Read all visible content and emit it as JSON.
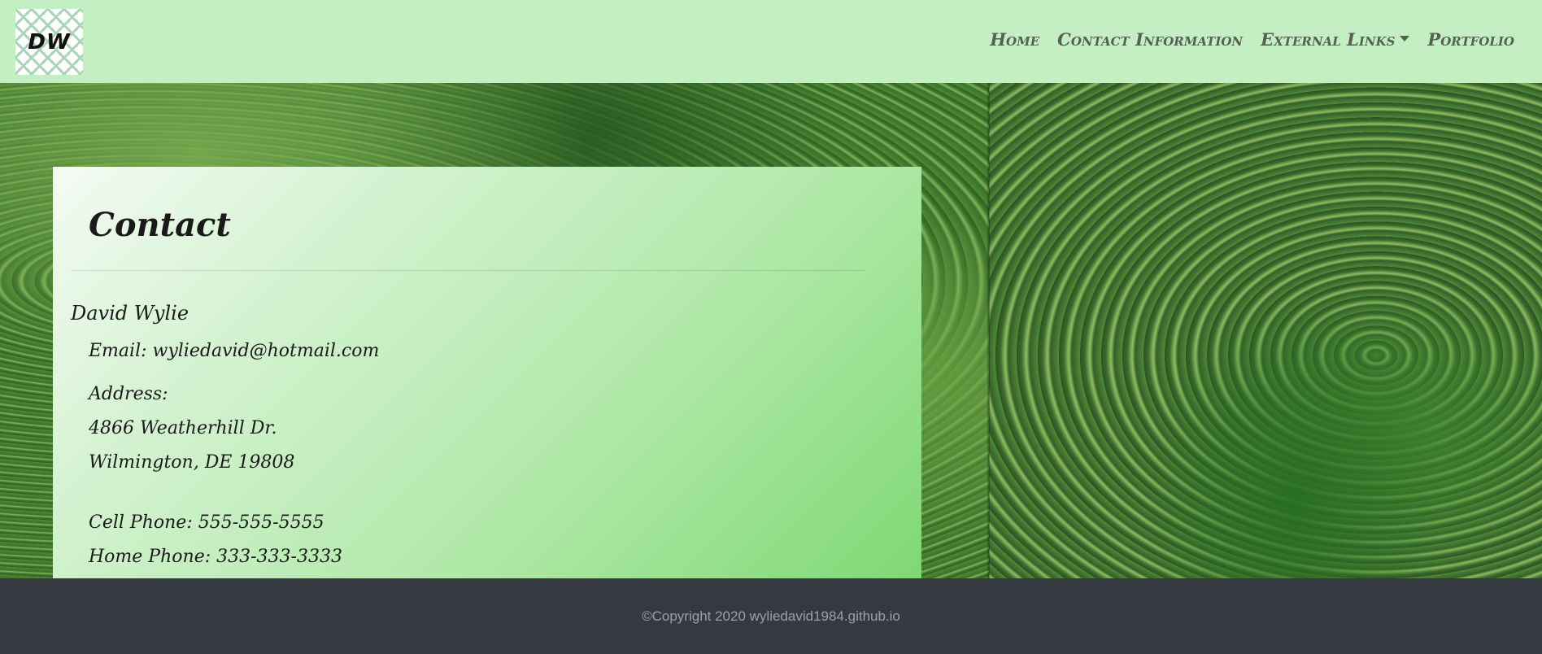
{
  "navbar": {
    "logo_text": "DW",
    "links": {
      "home": "Home",
      "contact": "Contact Information",
      "external": "External Links",
      "portfolio": "Portfolio"
    }
  },
  "contact": {
    "title": "Contact",
    "name": "David Wylie",
    "email": "Email: wyliedavid@hotmail.com",
    "address_label": "Address:",
    "address_street": "4866 Weatherhill Dr.",
    "address_city": "Wilmington, DE 19808",
    "cell_phone": "Cell Phone: 555-555-5555",
    "home_phone": "Home Phone: 333-333-3333"
  },
  "footer": {
    "copyright": "©Copyright 2020 wyliedavid1984.github.io"
  },
  "colors": {
    "navbar_bg": "#c4efc3",
    "card_gradient_start": "#f5fbf4",
    "card_gradient_end": "#7fd873",
    "footer_bg": "#343a40",
    "footer_text": "#9aa0a6",
    "nav_text": "#555f55"
  },
  "icons": {
    "dropdown": "caret-down-icon",
    "logo": "dw-logo"
  }
}
